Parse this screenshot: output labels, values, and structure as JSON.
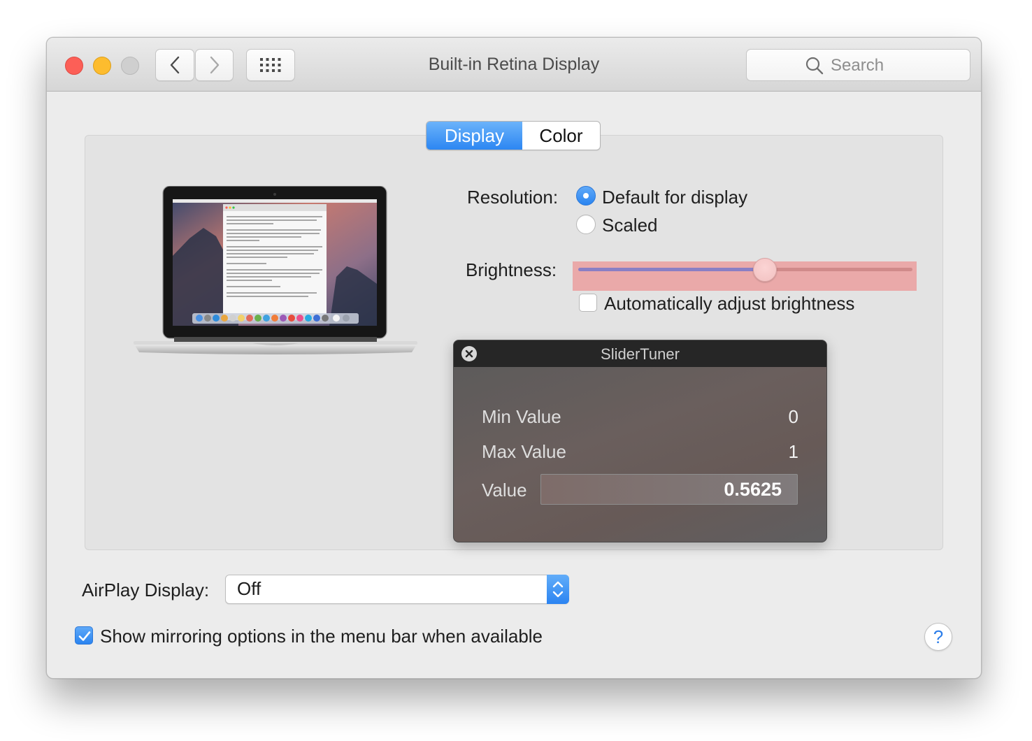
{
  "window": {
    "title": "Built-in Retina Display",
    "search_placeholder": "Search"
  },
  "tabs": [
    {
      "label": "Display",
      "selected": true
    },
    {
      "label": "Color",
      "selected": false
    }
  ],
  "resolution": {
    "label": "Resolution:",
    "options": [
      {
        "label": "Default for display",
        "selected": true
      },
      {
        "label": "Scaled",
        "selected": false
      }
    ]
  },
  "brightness": {
    "label": "Brightness:",
    "level": 0.5625,
    "auto_label": "Automatically adjust brightness",
    "auto_checked": false
  },
  "slider_tuner": {
    "title": "SliderTuner",
    "min_label": "Min Value",
    "min_value": "0",
    "max_label": "Max Value",
    "max_value": "1",
    "value_label": "Value",
    "value": "0.5625"
  },
  "airplay": {
    "label": "AirPlay Display:",
    "value": "Off"
  },
  "mirroring": {
    "label": "Show mirroring options in the menu bar when available",
    "checked": true
  },
  "help": "?",
  "colors": {
    "accent": "#2c86f2",
    "close": "#fc5f57",
    "minimize": "#fdbc2e",
    "highlight": "#eaa9a9"
  }
}
